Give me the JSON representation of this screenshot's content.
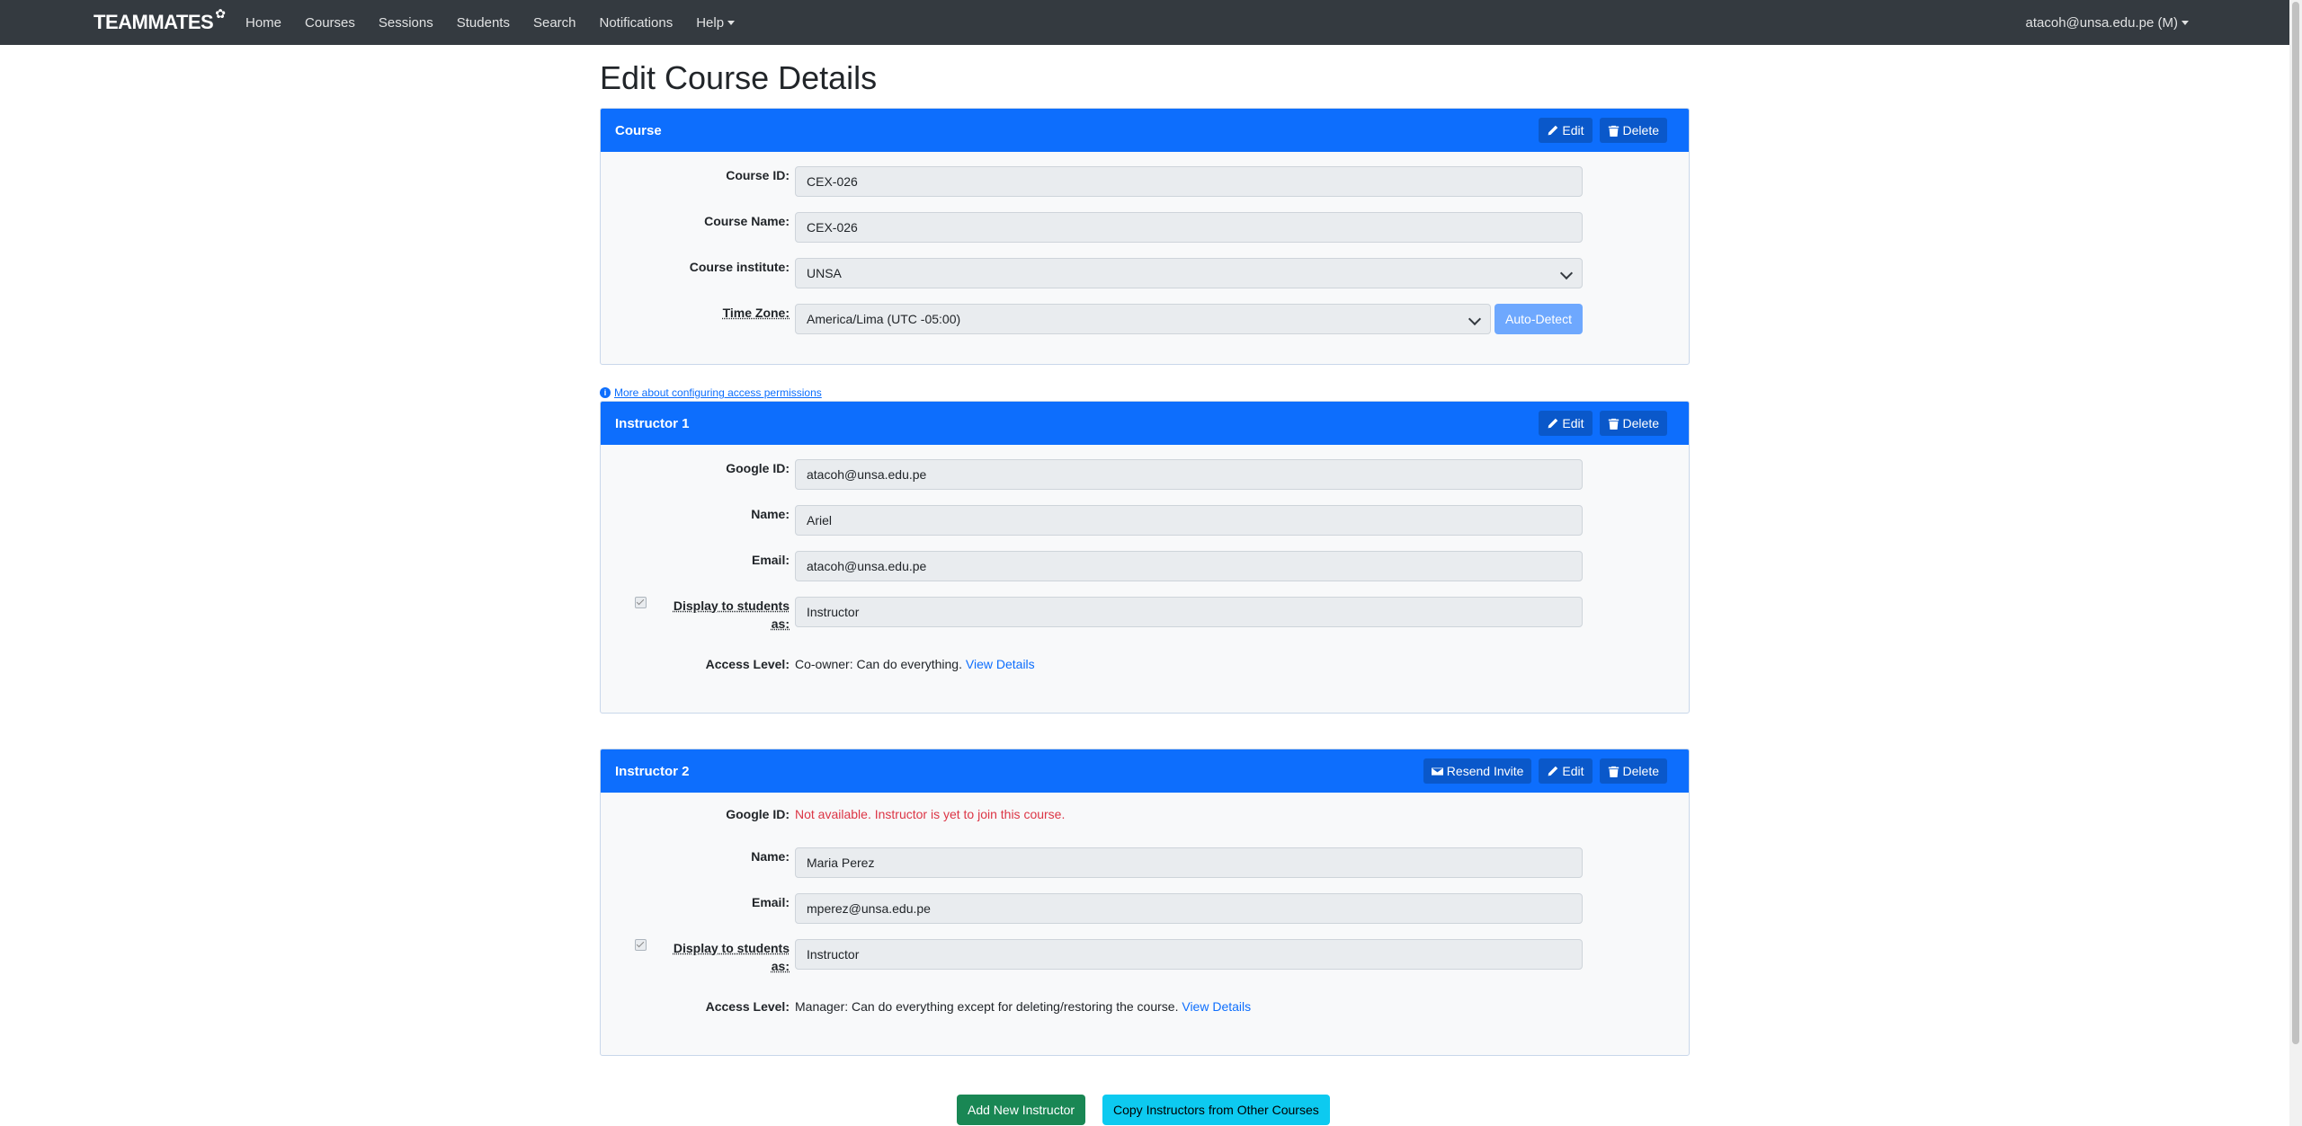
{
  "navbar": {
    "brand": "TEAMMATES",
    "links": [
      "Home",
      "Courses",
      "Sessions",
      "Students",
      "Search",
      "Notifications",
      "Help"
    ],
    "user": "atacoh@unsa.edu.pe (M)"
  },
  "page_title": "Edit Course Details",
  "course": {
    "header": "Course",
    "edit_label": "Edit",
    "delete_label": "Delete",
    "fields": {
      "course_id_label": "Course ID:",
      "course_id": "CEX-026",
      "course_name_label": "Course Name:",
      "course_name": "CEX-026",
      "institute_label": "Course institute:",
      "institute": "UNSA",
      "timezone_label": "Time Zone:",
      "timezone": "America/Lima (UTC -05:00)",
      "auto_detect": "Auto-Detect"
    }
  },
  "permissions_link": "More about configuring access permissions",
  "instructors": [
    {
      "header": "Instructor 1",
      "edit_label": "Edit",
      "delete_label": "Delete",
      "google_id_label": "Google ID:",
      "google_id": "atacoh@unsa.edu.pe",
      "name_label": "Name:",
      "name": "Ariel",
      "email_label": "Email:",
      "email": "atacoh@unsa.edu.pe",
      "display_label_1": "Display to students",
      "display_label_2": "as:",
      "display_as": "Instructor",
      "access_label": "Access Level:",
      "access_text": "Co-owner: Can do everything.",
      "view_details": "View Details"
    },
    {
      "header": "Instructor 2",
      "resend_label": "Resend Invite",
      "edit_label": "Edit",
      "delete_label": "Delete",
      "google_id_label": "Google ID:",
      "google_id_text": "Not available. Instructor is yet to join this course.",
      "name_label": "Name:",
      "name": "Maria Perez",
      "email_label": "Email:",
      "email": "mperez@unsa.edu.pe",
      "display_label_1": "Display to students",
      "display_label_2": "as:",
      "display_as": "Instructor",
      "access_label": "Access Level:",
      "access_text": "Manager: Can do everything except for deleting/restoring the course.",
      "view_details": "View Details"
    }
  ],
  "buttons": {
    "add_instructor": "Add New Instructor",
    "copy_instructors": "Copy Instructors from Other Courses"
  },
  "colors": {
    "navbar": "#343a40",
    "card_header": "#0d6efd",
    "danger_text": "#dc3545",
    "success": "#198754",
    "info": "#0dcaf0"
  }
}
